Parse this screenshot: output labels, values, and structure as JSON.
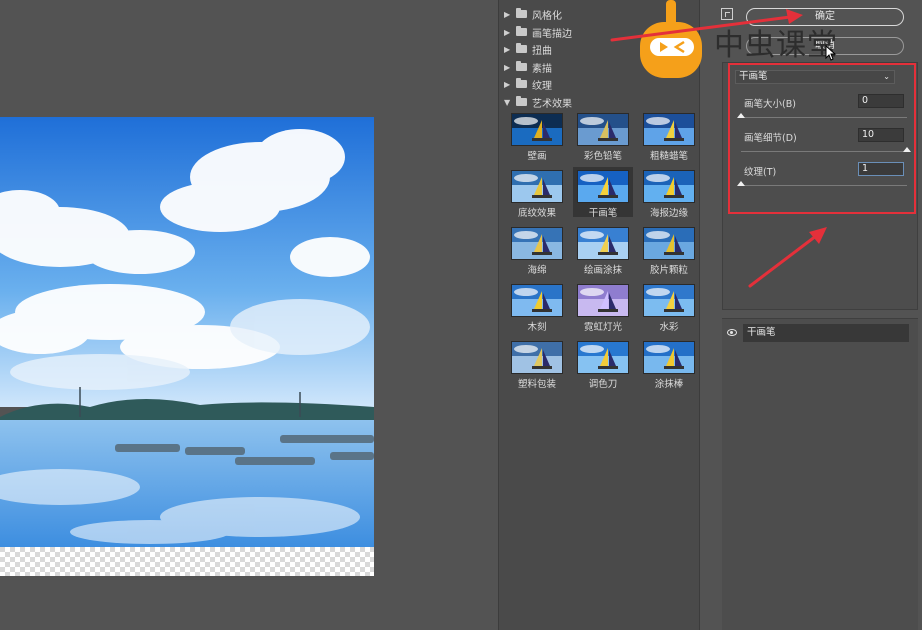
{
  "gallery": {
    "categories": [
      {
        "label": "风格化",
        "expanded": false
      },
      {
        "label": "画笔描边",
        "expanded": false
      },
      {
        "label": "扭曲",
        "expanded": false
      },
      {
        "label": "素描",
        "expanded": false
      },
      {
        "label": "纹理",
        "expanded": false
      },
      {
        "label": "艺术效果",
        "expanded": true
      }
    ],
    "filters": [
      {
        "label": "壁画"
      },
      {
        "label": "彩色铅笔"
      },
      {
        "label": "粗糙蜡笔"
      },
      {
        "label": "底纹效果"
      },
      {
        "label": "干画笔",
        "selected": true
      },
      {
        "label": "海报边缘"
      },
      {
        "label": "海绵"
      },
      {
        "label": "绘画涂抹"
      },
      {
        "label": "胶片颗粒"
      },
      {
        "label": "木刻"
      },
      {
        "label": "霓虹灯光"
      },
      {
        "label": "水彩"
      },
      {
        "label": "塑料包装"
      },
      {
        "label": "调色刀"
      },
      {
        "label": "涂抹棒"
      }
    ]
  },
  "buttons": {
    "ok": "确定",
    "cancel": "取消"
  },
  "settings": {
    "filter_name": "干画笔",
    "params": [
      {
        "label": "画笔大小(B)",
        "value": "0",
        "level": 0
      },
      {
        "label": "画笔细节(D)",
        "value": "10",
        "level": 1
      },
      {
        "label": "纹理(T)",
        "value": "1",
        "level": 0
      }
    ]
  },
  "layers": {
    "items": [
      {
        "name": "干画笔",
        "visible": true
      }
    ]
  },
  "watermark": {
    "text": "中虫课堂"
  },
  "colors": {
    "annotation_red": "#e4303a",
    "panel_bg": "#535353",
    "sky_blue": "#3a8ee0"
  }
}
